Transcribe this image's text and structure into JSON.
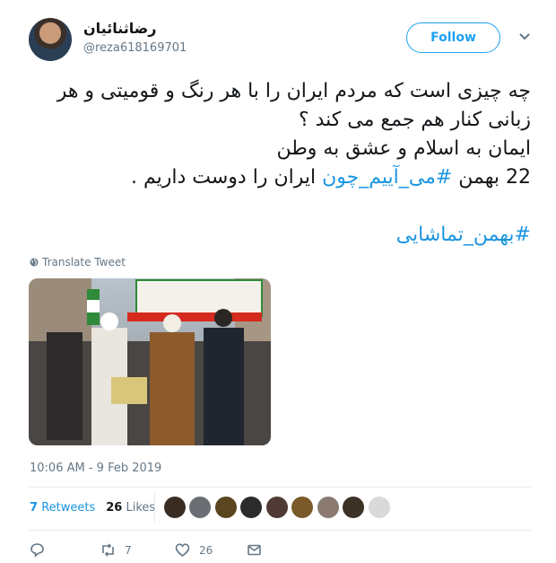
{
  "author": {
    "display_name": "رضاثنائیان",
    "handle": "@reza618169701"
  },
  "follow_label": "Follow",
  "tweet": {
    "line1": "چه چیزی است که مردم ایران را با هر رنگ و قومیتی و هر",
    "line2": "زبانی کنار هم جمع می کند ؟",
    "line3": "ایمان به اسلام و عشق به وطن",
    "line4_prefix": "22 بهمن ",
    "line4_hashtag": "#می_آییم_چون",
    "line4_suffix": " ایران را دوست داریم .",
    "hashtag2": "#بهمن_تماشایی"
  },
  "translate_label": "Translate Tweet",
  "timestamp": "10:06 AM - 9 Feb 2019",
  "stats": {
    "retweets_count": "7",
    "retweets_label": "Retweets",
    "likes_count": "26",
    "likes_label": "Likes"
  },
  "actions": {
    "retweet_count": "7",
    "like_count": "26"
  },
  "colors": {
    "accent": "#1da1f2",
    "link": "#1b95e0",
    "muted": "#657786"
  }
}
